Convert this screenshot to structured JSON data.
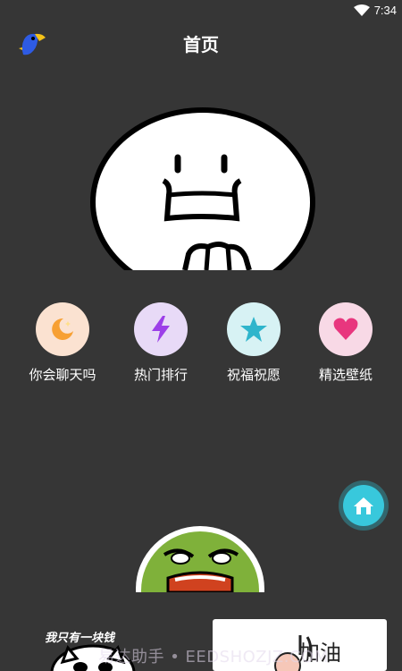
{
  "status_bar": {
    "time": "7:34"
  },
  "header": {
    "title": "首页"
  },
  "menu": [
    {
      "label": "你会聊天吗",
      "icon": "moon-icon",
      "color": "#F7A033",
      "bg": "#FBE2D1"
    },
    {
      "label": "热门排行",
      "icon": "lightning-icon",
      "color": "#9C3FE8",
      "bg": "#E8DAF7"
    },
    {
      "label": "祝福祝愿",
      "icon": "star-icon",
      "color": "#2FB5CC",
      "bg": "#D7F2F4"
    },
    {
      "label": "精选壁纸",
      "icon": "heart-icon",
      "color": "#E8367E",
      "bg": "#F8D9E6"
    }
  ],
  "stickers": {
    "left_caption": "我只有一块钱",
    "right_caption": "加油"
  },
  "watermark": "易达助手 • EEDSHOZJZ.COM"
}
